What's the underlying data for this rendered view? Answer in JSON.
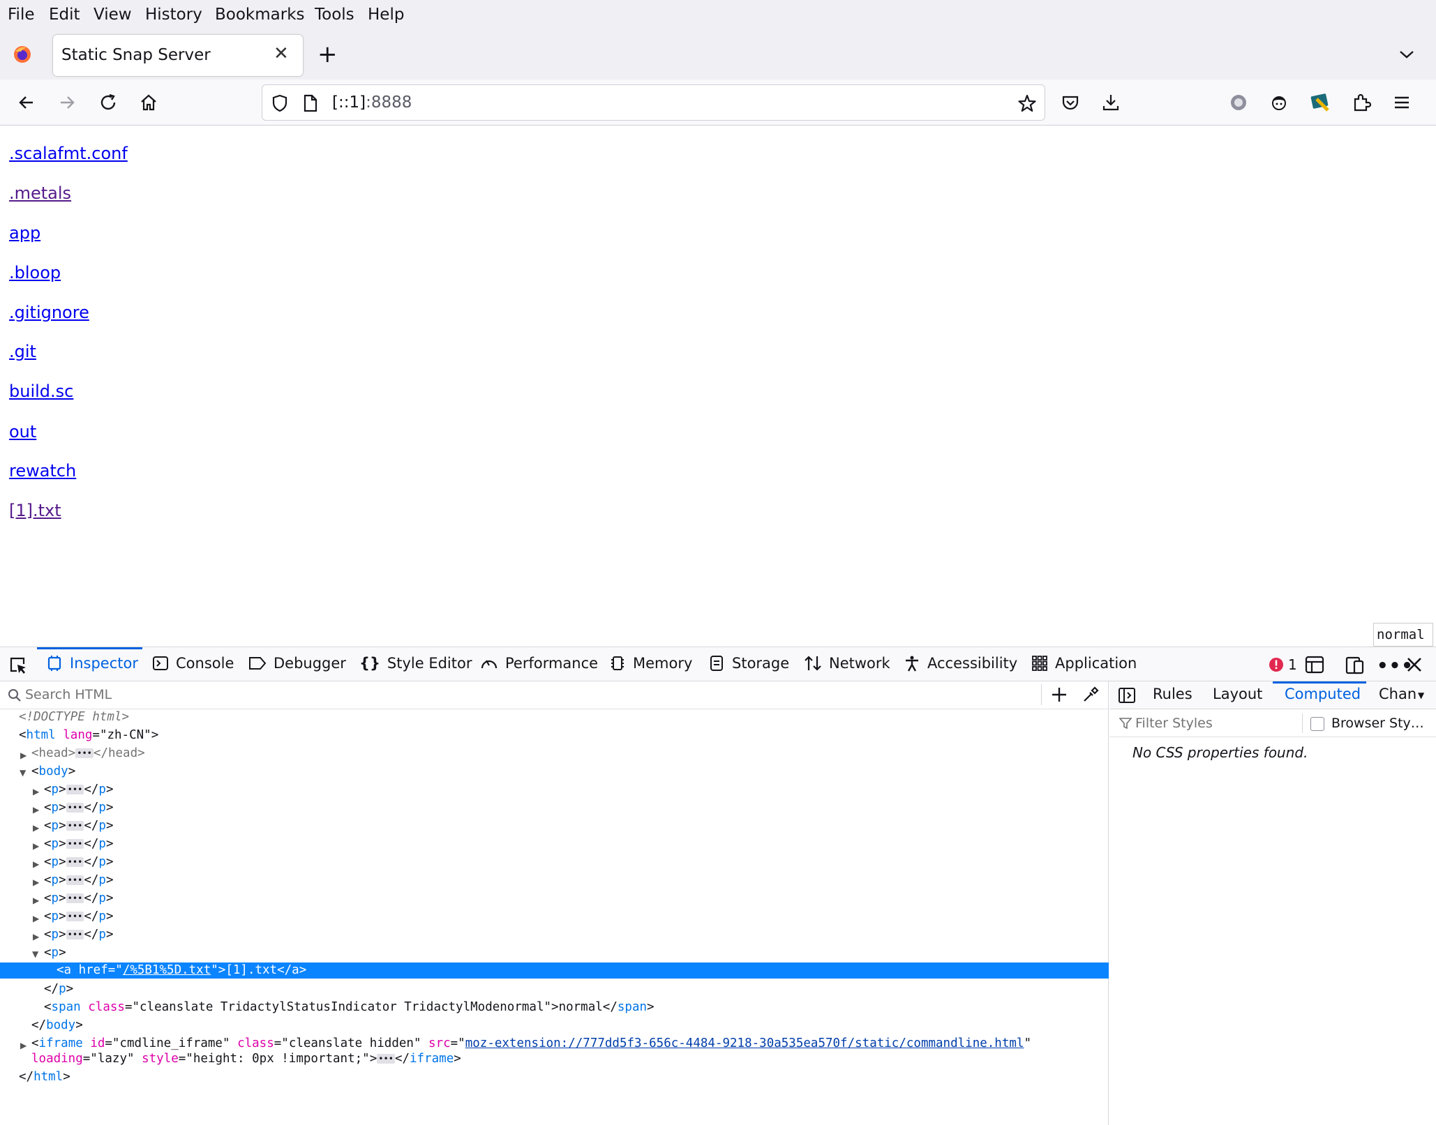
{
  "menubar": [
    "File",
    "Edit",
    "View",
    "History",
    "Bookmarks",
    "Tools",
    "Help"
  ],
  "tab": {
    "title": "Static Snap Server",
    "close": "✕"
  },
  "new_tab": "+",
  "address": {
    "host": "[::1]",
    "port": ":8888"
  },
  "links": [
    {
      "text": ".scalafmt.conf",
      "visited": false
    },
    {
      "text": ".metals",
      "visited": true
    },
    {
      "text": "app",
      "visited": false
    },
    {
      "text": ".bloop",
      "visited": false
    },
    {
      "text": ".gitignore",
      "visited": false
    },
    {
      "text": ".git",
      "visited": false
    },
    {
      "text": "build.sc",
      "visited": false
    },
    {
      "text": "out",
      "visited": false
    },
    {
      "text": "rewatch",
      "visited": false
    },
    {
      "text": "[1].txt",
      "visited": true
    }
  ],
  "status_indicator": "normal",
  "devtools": {
    "tabs": [
      "Inspector",
      "Console",
      "Debugger",
      "Style Editor",
      "Performance",
      "Memory",
      "Storage",
      "Network",
      "Accessibility",
      "Application"
    ],
    "error_count": "1",
    "search_placeholder": "Search HTML",
    "sidebar_tabs": [
      "Rules",
      "Layout",
      "Computed",
      "Chan"
    ],
    "filter_placeholder": "Filter Styles",
    "browser_styles_label": "Browser Sty…",
    "no_css": "No CSS properties found."
  },
  "markup": {
    "doctype": "<!DOCTYPE html>",
    "html_lang": "zh-CN",
    "selected_href": "/%5B1%5D.txt",
    "selected_text": "[1].txt",
    "span_class": "cleanslate TridactylStatusIndicator TridactylModenormal",
    "span_text": "normal",
    "iframe_id": "cmdline_iframe",
    "iframe_class": "cleanslate hidden",
    "iframe_src": "moz-extension://777dd5f3-656c-4484-9218-30a535ea570f/static/commandline.html",
    "iframe_loading": "lazy",
    "iframe_style": "height: 0px !important;"
  },
  "colors": {
    "link": "#0000ee",
    "visited": "#551a8b",
    "accent": "#0061e0",
    "selection": "#0a84ff"
  }
}
